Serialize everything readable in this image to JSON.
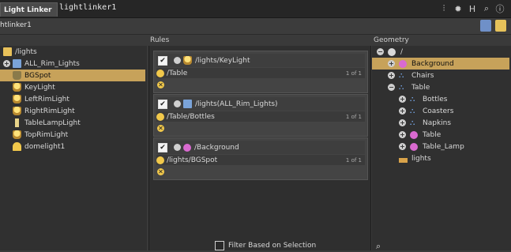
{
  "tab": {
    "label": "Light Linker",
    "node_name": "lightlinker1"
  },
  "path": {
    "label": "htlinker1"
  },
  "panes": {
    "rules_title": "Rules",
    "geometry_title": "Geometry"
  },
  "lights_tree": [
    {
      "label": "/lights",
      "icon": "folder-icon"
    },
    {
      "label": "ALL_Rim_Lights",
      "icon": "folder-icon"
    },
    {
      "label": "BGSpot",
      "icon": "spotlight-icon",
      "selected": true
    },
    {
      "label": "KeyLight",
      "icon": "lamp-icon"
    },
    {
      "label": "LeftRimLight",
      "icon": "lamp-icon"
    },
    {
      "label": "RightRimLight",
      "icon": "lamp-icon"
    },
    {
      "label": "TableLampLight",
      "icon": "lamp-icon"
    },
    {
      "label": "TopRimLight",
      "icon": "lamp-icon"
    },
    {
      "label": "domelight1",
      "icon": "dome-icon"
    }
  ],
  "rules": [
    {
      "light": "/lights/KeyLight",
      "object": "/Table",
      "count": "1 of 1"
    },
    {
      "light": "/lights(ALL_Rim_Lights)",
      "object": "/Table/Bottles",
      "count": "1 of 1"
    },
    {
      "light": "/Background",
      "object": "/lights/BGSpot",
      "count": "1 of 1"
    }
  ],
  "geometry_tree": [
    {
      "label": "/",
      "icon": "root-icon"
    },
    {
      "label": "Background",
      "icon": "sphere-icon",
      "selected": true
    },
    {
      "label": "Chairs",
      "icon": "network-icon"
    },
    {
      "label": "Table",
      "icon": "network-icon"
    },
    {
      "label": "Bottles",
      "icon": "network-icon"
    },
    {
      "label": "Coasters",
      "icon": "network-icon"
    },
    {
      "label": "Napkins",
      "icon": "network-icon"
    },
    {
      "label": "Table",
      "icon": "sphere-icon"
    },
    {
      "label": "Table_Lamp",
      "icon": "sphere-icon"
    },
    {
      "label": "lights",
      "icon": "light-folder-icon"
    }
  ],
  "bottom": {
    "filter_label": "Filter Based on Selection"
  },
  "colors": {
    "selection": "#c7a25a",
    "background": "#3a3a3a",
    "accent_light": "#f1c84b",
    "geo_sphere": "#d96ad0"
  }
}
